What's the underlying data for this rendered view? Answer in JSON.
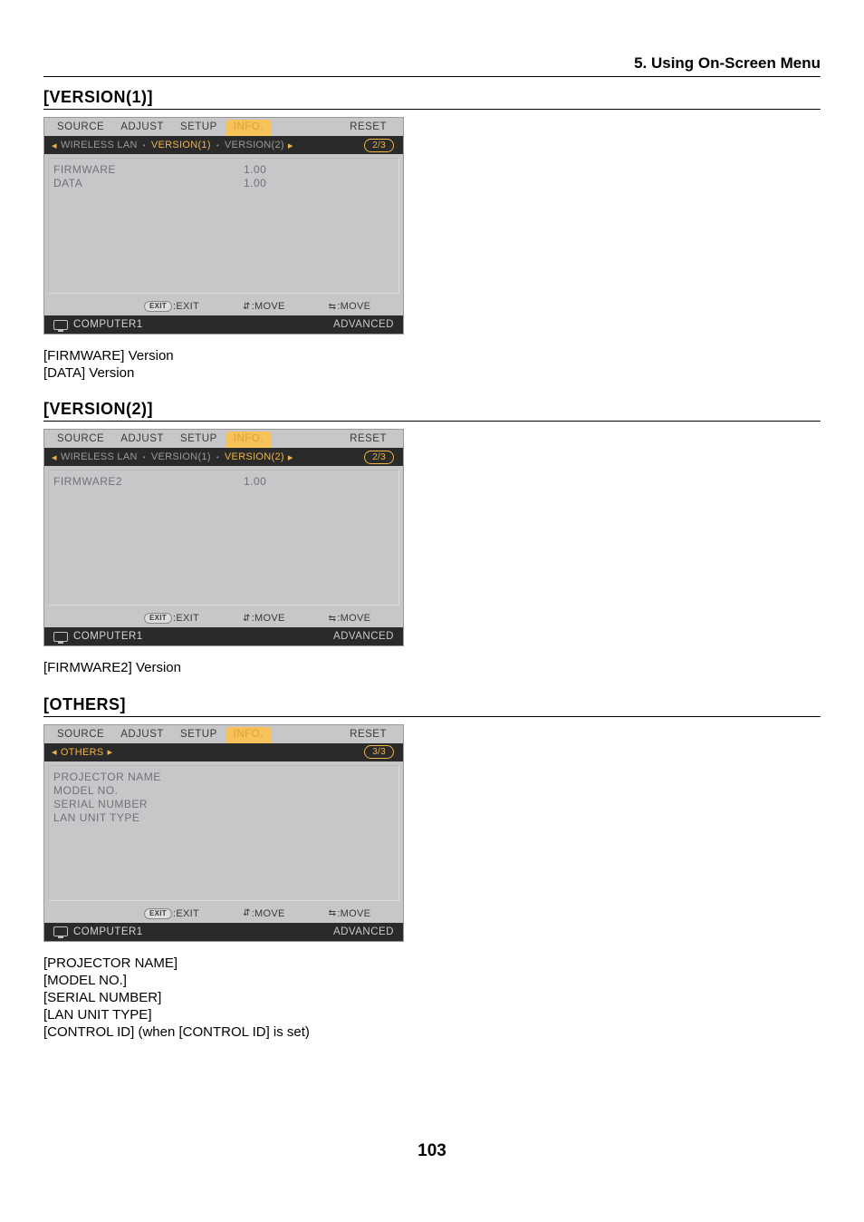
{
  "chapter": "5. Using On-Screen Menu",
  "page_number": "103",
  "common": {
    "tabs": {
      "source": "SOURCE",
      "adjust": "ADJUST",
      "setup": "SETUP",
      "info": "INFO.",
      "reset": "RESET"
    },
    "hints": {
      "exit": ":EXIT",
      "exit_chip": "EXIT",
      "move_ud": ":MOVE",
      "move_lr": ":MOVE"
    },
    "status": {
      "source": "COMPUTER1",
      "mode": "ADVANCED"
    }
  },
  "screens": [
    {
      "title": "[VERSION(1)]",
      "sub_items": [
        "WIRELESS LAN",
        "VERSION(1)",
        "VERSION(2)"
      ],
      "active_sub": 1,
      "page_badge": "2/3",
      "rows": [
        {
          "label": "FIRMWARE",
          "value": "1.00"
        },
        {
          "label": "DATA",
          "value": "1.00"
        }
      ],
      "caption": [
        "[FIRMWARE] Version",
        "[DATA] Version"
      ]
    },
    {
      "title": "[VERSION(2)]",
      "sub_items": [
        "WIRELESS LAN",
        "VERSION(1)",
        "VERSION(2)"
      ],
      "active_sub": 2,
      "page_badge": "2/3",
      "rows": [
        {
          "label": "FIRMWARE2",
          "value": "1.00"
        }
      ],
      "caption": [
        "[FIRMWARE2] Version"
      ]
    },
    {
      "title": "[OTHERS]",
      "sub_items": [
        "OTHERS"
      ],
      "active_sub": 0,
      "page_badge": "3/3",
      "rows": [
        {
          "label": "PROJECTOR NAME",
          "value": ""
        },
        {
          "label": "MODEL NO.",
          "value": ""
        },
        {
          "label": "SERIAL NUMBER",
          "value": ""
        },
        {
          "label": "LAN UNIT TYPE",
          "value": ""
        }
      ],
      "caption": [
        "[PROJECTOR NAME]",
        "[MODEL NO.]",
        "[SERIAL NUMBER]",
        "[LAN UNIT TYPE]",
        "[CONTROL ID] (when [CONTROL ID] is set)"
      ]
    }
  ]
}
